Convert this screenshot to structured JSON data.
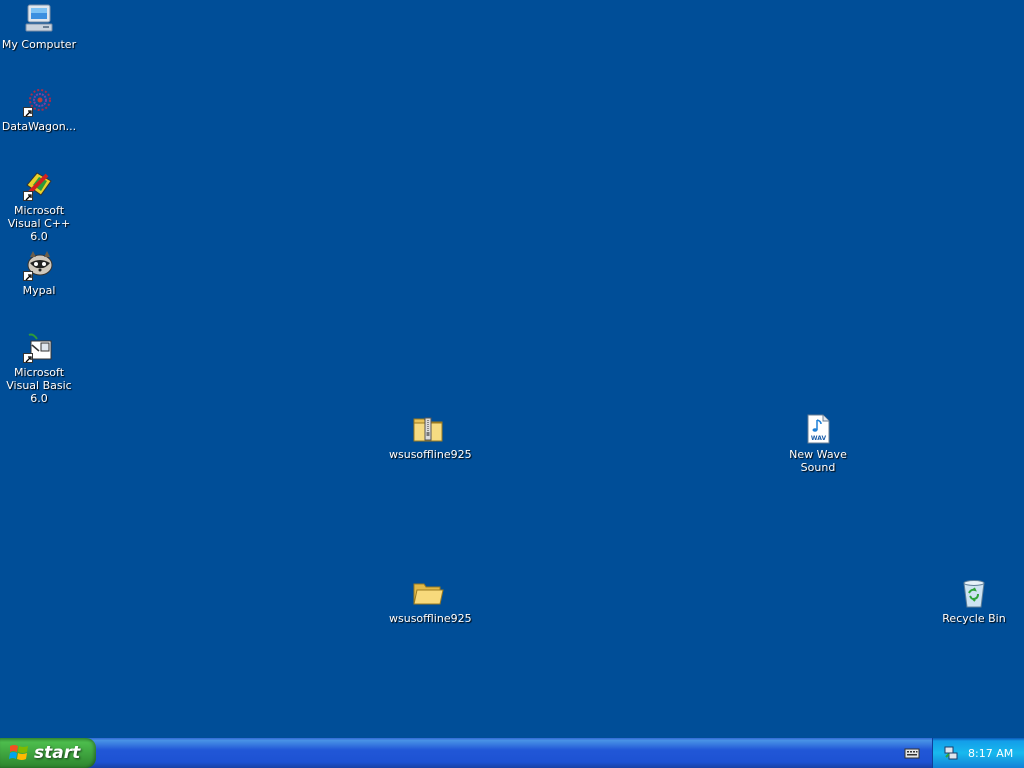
{
  "desktop": {
    "background_color": "#004e98",
    "icons": [
      {
        "label": "My Computer",
        "icon": "my-computer-icon"
      },
      {
        "label": "DataWagon...",
        "icon": "datawagon-shortcut-icon"
      },
      {
        "label": "Microsoft Visual C++ 6.0",
        "icon": "visual-cpp-shortcut-icon"
      },
      {
        "label": "Mypal",
        "icon": "mypal-shortcut-icon"
      },
      {
        "label": "Microsoft Visual Basic 6.0",
        "icon": "visual-basic-shortcut-icon"
      },
      {
        "label": "wsusoffline925",
        "icon": "zip-folder-icon"
      },
      {
        "label": "New Wave Sound",
        "icon": "wav-file-icon"
      },
      {
        "label": "wsusoffline925",
        "icon": "folder-icon"
      },
      {
        "label": "Recycle Bin",
        "icon": "recycle-bin-icon"
      }
    ]
  },
  "taskbar": {
    "start_label": "start",
    "clock": "8:17 AM",
    "colors": {
      "taskbar": "#245edb",
      "start": "#3c9f3c",
      "tray": "#18b9ee"
    }
  }
}
